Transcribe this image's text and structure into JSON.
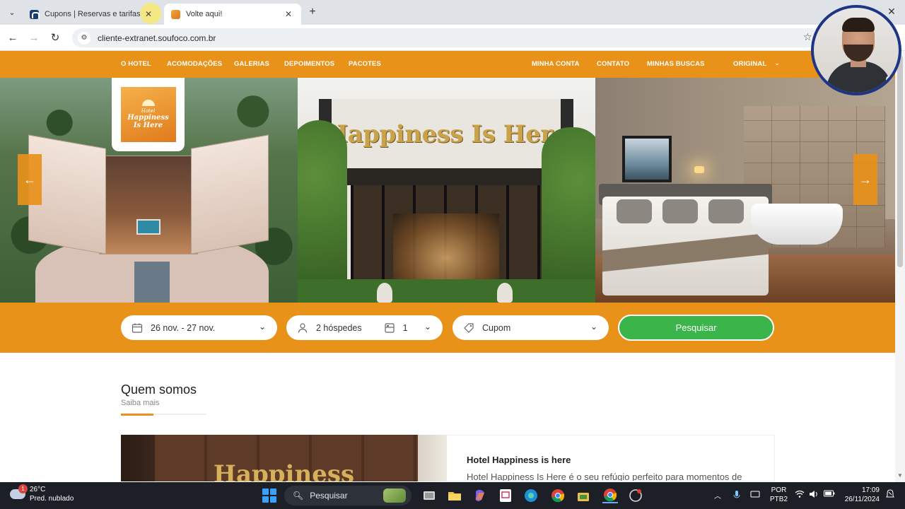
{
  "browser": {
    "tabs": [
      {
        "title": "Cupons | Reservas e tarifas",
        "active": false
      },
      {
        "title": "Volte aqui!",
        "active": true
      }
    ],
    "url": "cliente-extranet.soufoco.com.br"
  },
  "site": {
    "nav_left": [
      "O HOTEL",
      "ACOMODAÇÕES",
      "GALERIAS",
      "DEPOIMENTOS",
      "PACOTES"
    ],
    "nav_right": [
      "MINHA CONTA",
      "CONTATO",
      "MINHAS BUSCAS",
      "ORIGINAL"
    ],
    "accent_color": "#e8921a",
    "hero": {
      "logo_line1": "Hotel",
      "logo_line2": "Happiness",
      "logo_line3": "Is Here",
      "sign_text": "Happiness Is Here"
    },
    "search": {
      "dates": "26 nov. - 27 nov.",
      "guests": "2 hóspedes",
      "rooms": "1",
      "coupon_placeholder": "Cupom",
      "search_button": "Pesquisar",
      "search_button_color": "#3bb54a"
    },
    "about": {
      "title": "Quem somos",
      "subtitle": "Saiba mais",
      "image_text": "Happiness",
      "card_title": "Hotel Happiness is here",
      "card_text": "Hotel Happiness Is Here é o seu refúgio perfeito para momentos de"
    }
  },
  "taskbar": {
    "weather_temp": "26°C",
    "weather_desc": "Pred. nublado",
    "weather_badge": "1",
    "search_placeholder": "Pesquisar",
    "lang_line1": "POR",
    "lang_line2": "PTB2",
    "time": "17:09",
    "date": "26/11/2024"
  }
}
